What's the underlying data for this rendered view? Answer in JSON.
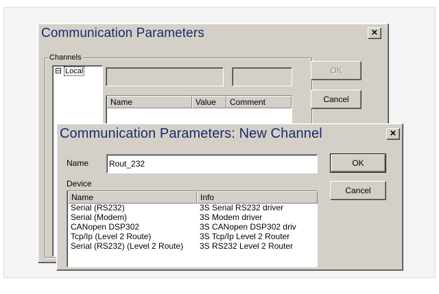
{
  "back_dialog": {
    "title": "Communication Parameters",
    "close_glyph": "×",
    "channels_label": "Channels",
    "tree_expander": "⊟",
    "tree_item": "Local",
    "ok_label": "OK",
    "cancel_label": "Cancel",
    "columns": [
      "Name",
      "Value",
      "Comment"
    ]
  },
  "front_dialog": {
    "title": "Communication Parameters: New Channel",
    "close_glyph": "×",
    "name_label": "Name",
    "name_value": "Rout_232",
    "device_label": "Device",
    "ok_label": "OK",
    "cancel_label": "Cancel",
    "columns": [
      "Name",
      "Info"
    ],
    "devices": [
      {
        "name": "Serial (RS232)",
        "info": "3S Serial RS232 driver"
      },
      {
        "name": "Serial (Modem)",
        "info": "3S Modem driver"
      },
      {
        "name": "CANopen DSP302",
        "info": "3S CANopen DSP302 driv"
      },
      {
        "name": "Tcp/Ip (Level 2 Route)",
        "info": "3S Tcp/Ip Level 2 Router"
      },
      {
        "name": "Serial (RS232) (Level 2 Route)",
        "info": "3S RS232 Level 2 Router"
      }
    ]
  },
  "colors": {
    "dialog_face": "#d4d0c8",
    "title_text": "#1a2a6c",
    "selection": "#000080"
  }
}
